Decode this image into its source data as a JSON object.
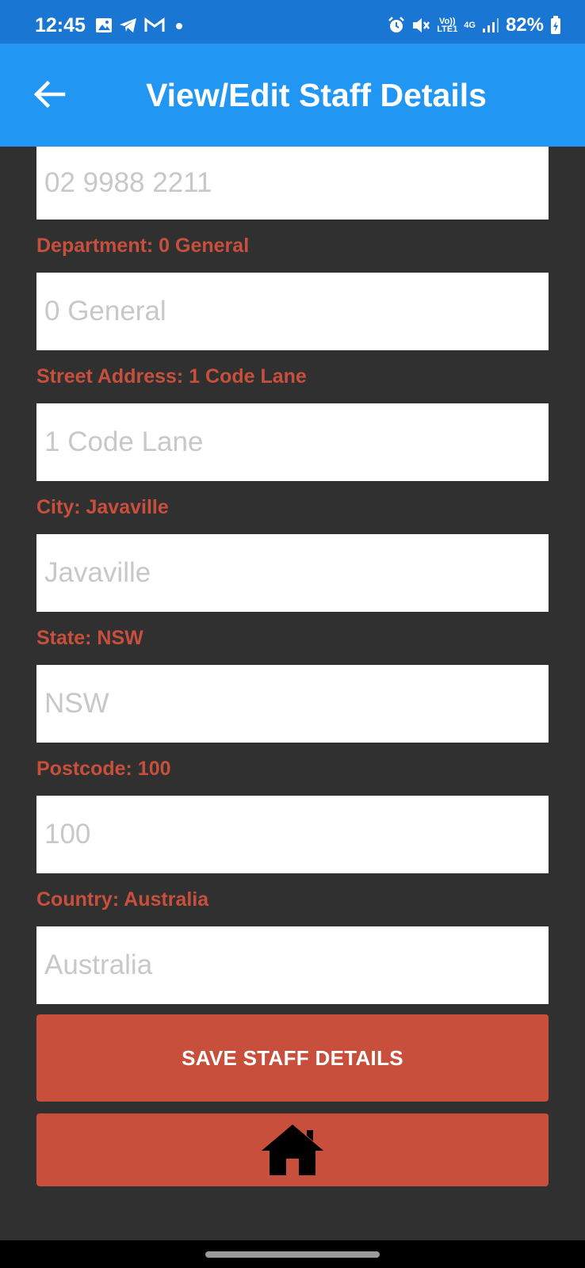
{
  "status_bar": {
    "time": "12:45",
    "network": "4G",
    "volte": "Vo)) LTE1",
    "battery": "82%",
    "icons": [
      "gallery-icon",
      "telegram-icon",
      "gmail-icon",
      "dot-icon",
      "alarm-icon",
      "mute-icon",
      "volte-icon",
      "signal-icon",
      "battery-icon"
    ]
  },
  "app_bar": {
    "title": "View/Edit Staff Details",
    "back_icon": "arrow-left-icon"
  },
  "form": {
    "phone": {
      "placeholder": "02 9988 2211"
    },
    "department": {
      "label": "Department: 0 General",
      "placeholder": "0 General"
    },
    "street": {
      "label": "Street Address: 1 Code Lane",
      "placeholder": "1 Code Lane"
    },
    "city": {
      "label": "City: Javaville",
      "placeholder": "Javaville"
    },
    "state": {
      "label": "State: NSW",
      "placeholder": "NSW"
    },
    "postcode": {
      "label": "Postcode: 100",
      "placeholder": "100"
    },
    "country": {
      "label": "Country: Australia",
      "placeholder": "Australia"
    }
  },
  "buttons": {
    "save_label": "SAVE STAFF DETAILS",
    "home_icon": "home-icon"
  },
  "colors": {
    "status_bar": "#1976d2",
    "app_bar": "#2196f3",
    "background": "#303030",
    "accent": "#c84f3c"
  }
}
